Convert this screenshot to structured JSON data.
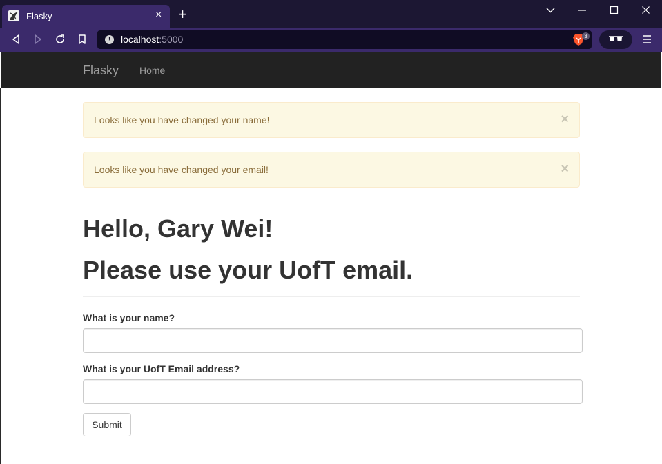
{
  "browser": {
    "tab_title": "Flasky",
    "tab_close": "×",
    "new_tab": "+",
    "url_host": "localhost",
    "url_port": ":5000",
    "shields_count": "3",
    "colors": {
      "titlebar": "#1c1733",
      "toolbar": "#3b2a6b",
      "urlbar": "#100c24"
    }
  },
  "navbar": {
    "brand": "Flasky",
    "links": [
      "Home"
    ]
  },
  "alerts": [
    {
      "text": "Looks like you have changed your name!",
      "close": "×"
    },
    {
      "text": "Looks like you have changed your email!",
      "close": "×"
    }
  ],
  "page": {
    "greeting": "Hello, Gary Wei!",
    "notice": "Please use your UofT email."
  },
  "form": {
    "name_label": "What is your name?",
    "name_value": "",
    "email_label": "What is your UofT Email address?",
    "email_value": "",
    "submit_label": "Submit"
  }
}
